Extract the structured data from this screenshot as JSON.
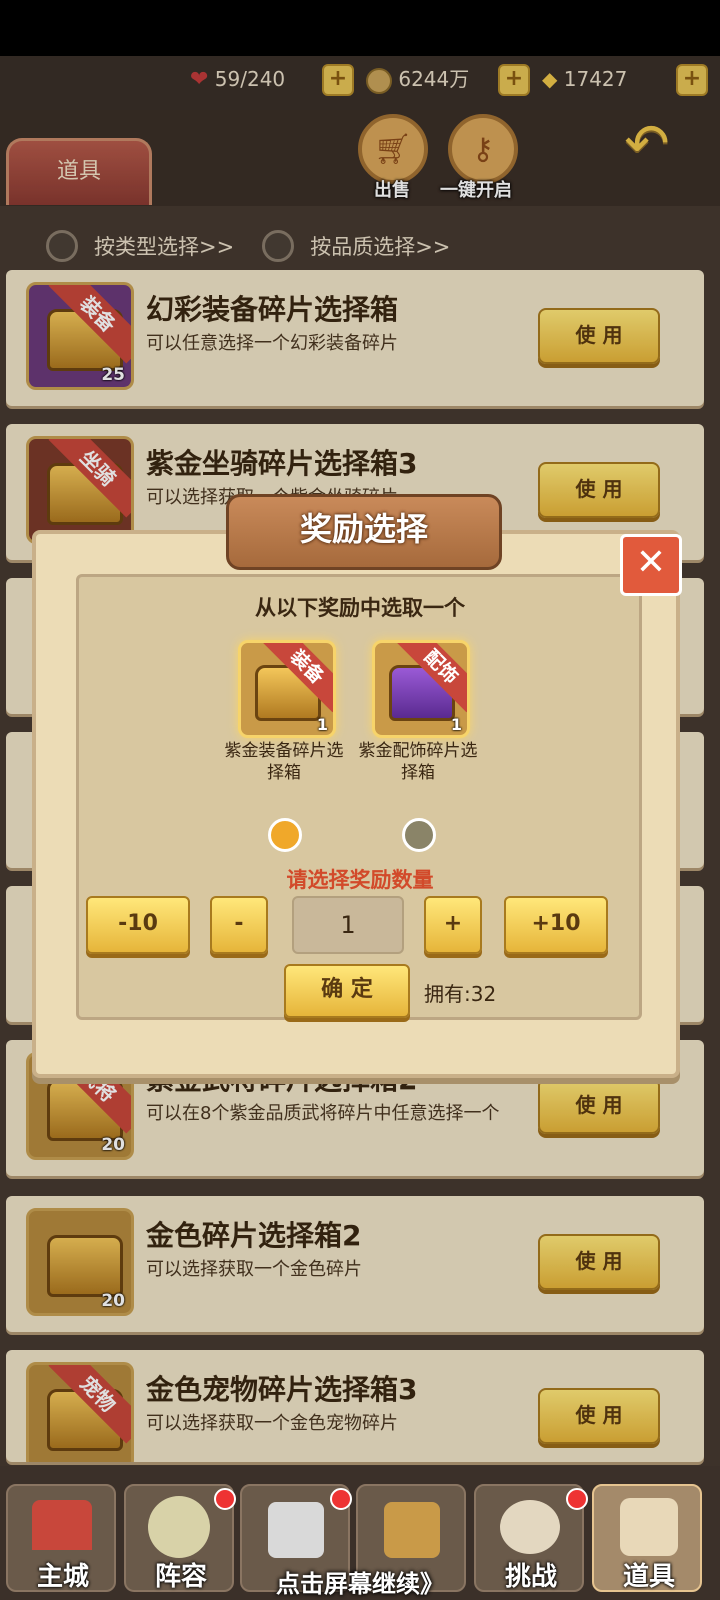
{
  "resources": {
    "stamina": "59/240",
    "coins": "6244万",
    "ingots": "17427"
  },
  "header": {
    "tab_label": "道具",
    "sell_label": "出售",
    "open_all_label": "一键开启"
  },
  "filters": {
    "by_type": "按类型选择>>",
    "by_quality": "按品质选择>>"
  },
  "items": [
    {
      "title": "幻彩装备碎片选择箱",
      "desc": "可以任意选择一个幻彩装备碎片",
      "badge": "装备",
      "count": "25",
      "use": "使 用"
    },
    {
      "title": "紫金坐骑碎片选择箱3",
      "desc": "可以选择获取一个紫金坐骑碎片",
      "badge": "坐骑",
      "count": "",
      "use": "使 用"
    },
    {
      "title": "紫金武将碎片选择箱2",
      "desc": "可以在8个紫金品质武将碎片中任意选择一个",
      "badge": "武将",
      "count": "20",
      "use": "使 用"
    },
    {
      "title": "金色碎片选择箱2",
      "desc": "可以选择获取一个金色碎片",
      "badge": "",
      "count": "20",
      "use": "使 用"
    },
    {
      "title": "金色宠物碎片选择箱3",
      "desc": "可以选择获取一个金色宠物碎片",
      "badge": "宠物",
      "count": "",
      "use": "使 用"
    }
  ],
  "dialog": {
    "title": "奖励选择",
    "close": "✕",
    "prompt": "从以下奖励中选取一个",
    "rewards": [
      {
        "name": "紫金装备碎片选择箱",
        "badge": "装备",
        "count": "1",
        "selected": true
      },
      {
        "name": "紫金配饰碎片选择箱",
        "badge": "配饰",
        "count": "1",
        "selected": false
      }
    ],
    "qty_prompt": "请选择奖励数量",
    "minus10": "-10",
    "minus": "-",
    "qty": "1",
    "plus": "+",
    "plus10": "+10",
    "confirm": "确 定",
    "owned": "拥有:32"
  },
  "nav": {
    "home": "主城",
    "lineup": "阵容",
    "challenge": "挑战",
    "items": "道具"
  },
  "continue_hint": "点击屏幕继续》",
  "colors": {
    "accent": "#e6b53a",
    "danger": "#e15a3c",
    "prompt_red": "#d24a2a"
  }
}
